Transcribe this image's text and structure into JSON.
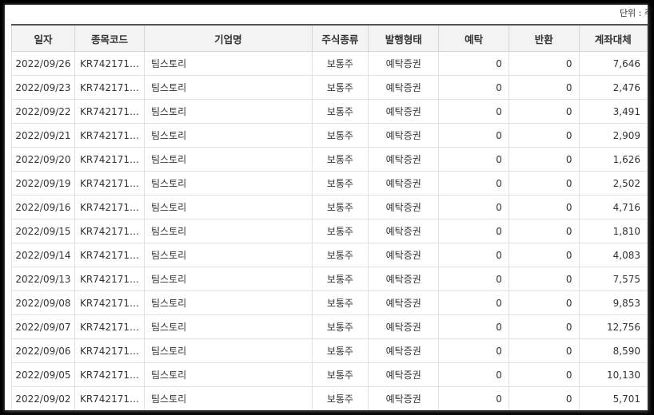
{
  "unit_label": "단위 : 주",
  "columns": [
    "일자",
    "종목코드",
    "기업명",
    "주식종류",
    "발행형태",
    "예탁",
    "반환",
    "계좌대체"
  ],
  "rows": [
    [
      "2022/09/26",
      "KR742171…",
      "팀스토리",
      "보통주",
      "예탁증권",
      "0",
      "0",
      "7,646"
    ],
    [
      "2022/09/23",
      "KR742171…",
      "팀스토리",
      "보통주",
      "예탁증권",
      "0",
      "0",
      "2,476"
    ],
    [
      "2022/09/22",
      "KR742171…",
      "팀스토리",
      "보통주",
      "예탁증권",
      "0",
      "0",
      "3,491"
    ],
    [
      "2022/09/21",
      "KR742171…",
      "팀스토리",
      "보통주",
      "예탁증권",
      "0",
      "0",
      "2,909"
    ],
    [
      "2022/09/20",
      "KR742171…",
      "팀스토리",
      "보통주",
      "예탁증권",
      "0",
      "0",
      "1,626"
    ],
    [
      "2022/09/19",
      "KR742171…",
      "팀스토리",
      "보통주",
      "예탁증권",
      "0",
      "0",
      "2,502"
    ],
    [
      "2022/09/16",
      "KR742171…",
      "팀스토리",
      "보통주",
      "예탁증권",
      "0",
      "0",
      "4,716"
    ],
    [
      "2022/09/15",
      "KR742171…",
      "팀스토리",
      "보통주",
      "예탁증권",
      "0",
      "0",
      "1,810"
    ],
    [
      "2022/09/14",
      "KR742171…",
      "팀스토리",
      "보통주",
      "예탁증권",
      "0",
      "0",
      "4,083"
    ],
    [
      "2022/09/13",
      "KR742171…",
      "팀스토리",
      "보통주",
      "예탁증권",
      "0",
      "0",
      "7,575"
    ],
    [
      "2022/09/08",
      "KR742171…",
      "팀스토리",
      "보통주",
      "예탁증권",
      "0",
      "0",
      "9,853"
    ],
    [
      "2022/09/07",
      "KR742171…",
      "팀스토리",
      "보통주",
      "예탁증권",
      "0",
      "0",
      "12,756"
    ],
    [
      "2022/09/06",
      "KR742171…",
      "팀스토리",
      "보통주",
      "예탁증권",
      "0",
      "0",
      "8,590"
    ],
    [
      "2022/09/05",
      "KR742171…",
      "팀스토리",
      "보통주",
      "예탁증권",
      "0",
      "0",
      "10,130"
    ],
    [
      "2022/09/02",
      "KR742171…",
      "팀스토리",
      "보통주",
      "예탁증권",
      "0",
      "0",
      "5,701"
    ]
  ]
}
